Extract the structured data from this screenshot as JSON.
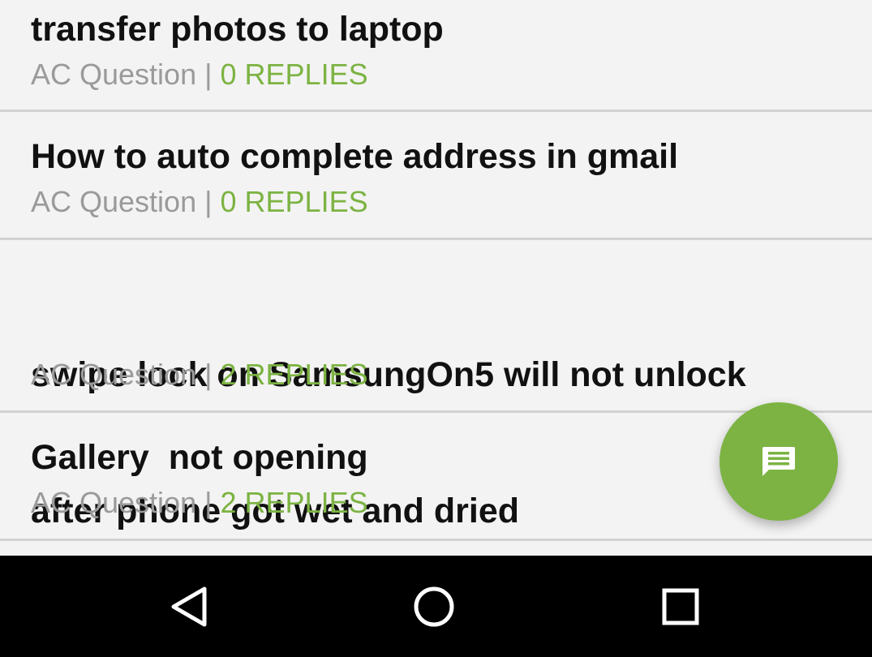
{
  "questions": [
    {
      "title_clipped": "transfer photos to laptop",
      "category": "AC Question",
      "separator": "|",
      "replies": "0 REPLIES"
    },
    {
      "title": "How to auto complete address in gmail",
      "category": "AC Question",
      "separator": "|",
      "replies": "0 REPLIES"
    },
    {
      "title_line1": "swipe lock on SamsungOn5 will not unlock",
      "title_line2": "after phone got wet and dried",
      "category": "AC Question",
      "separator": "|",
      "replies": "2 REPLIES"
    },
    {
      "title": "Gallery  not opening",
      "category": "AC Question",
      "separator": "|",
      "replies": "2 REPLIES"
    }
  ],
  "fab": {
    "icon": "chat-bubble-icon"
  },
  "navbar": {
    "back_icon": "back-triangle-icon",
    "home_icon": "home-circle-icon",
    "recents_icon": "recents-square-icon"
  },
  "colors": {
    "accent": "#7cb342",
    "background": "#f3f3f3",
    "navbar": "#000000",
    "muted": "#9a9a9a"
  }
}
